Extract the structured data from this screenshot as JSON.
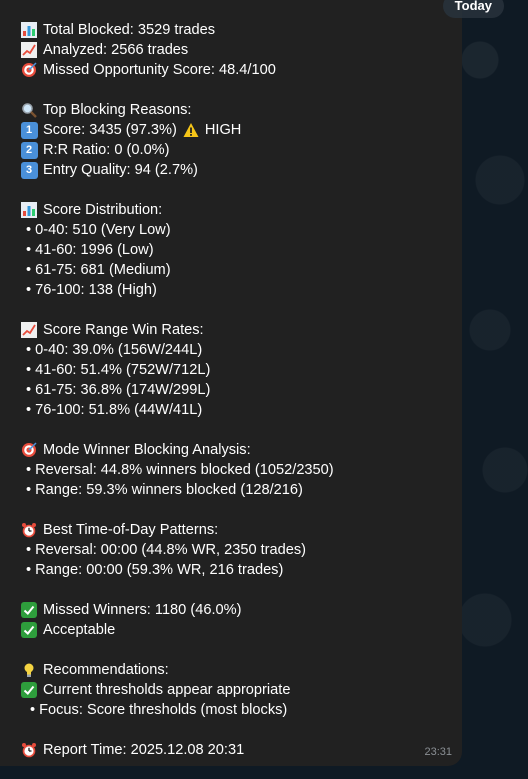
{
  "chat": {
    "date_label": "Today",
    "message_time": "23:31"
  },
  "message": {
    "summary": [
      "Total Blocked: 3529 trades",
      "Analyzed: 2566 trades",
      "Missed Opportunity Score: 48.4/100"
    ],
    "reasons": {
      "title": "Top Blocking Reasons:",
      "items": [
        {
          "key": "1",
          "text": "Score: 3435 (97.3%)",
          "badge": "HIGH"
        },
        {
          "key": "2",
          "text": "R:R Ratio: 0 (0.0%)"
        },
        {
          "key": "3",
          "text": "Entry Quality: 94 (2.7%)"
        }
      ]
    },
    "distribution": {
      "title": "Score Distribution:",
      "items": [
        "0-40: 510 (Very Low)",
        "41-60: 1996 (Low)",
        "61-75: 681 (Medium)",
        "76-100: 138 (High)"
      ]
    },
    "win_rates": {
      "title": "Score Range Win Rates:",
      "items": [
        "0-40: 39.0% (156W/244L)",
        "41-60: 51.4% (752W/712L)",
        "61-75: 36.8% (174W/299L)",
        "76-100: 51.8% (44W/41L)"
      ]
    },
    "mode": {
      "title": "Mode Winner Blocking Analysis:",
      "items": [
        "Reversal: 44.8% winners blocked (1052/2350)",
        "Range: 59.3% winners blocked (128/216)"
      ]
    },
    "time_patterns": {
      "title": "Best Time-of-Day Patterns:",
      "items": [
        "Reversal: 00:00 (44.8% WR, 2350 trades)",
        "Range: 00:00 (59.3% WR, 216 trades)"
      ]
    },
    "missed": {
      "line1": "Missed Winners: 1180 (46.0%)",
      "line2": "Acceptable"
    },
    "recommendations": {
      "title": "Recommendations:",
      "line1": "Current thresholds appear appropriate",
      "line2": "Focus: Score thresholds (most blocks)"
    },
    "report_time": "Report Time: 2025.12.08 20:31",
    "icons": {
      "chart": "bar-chart-icon",
      "trend": "chart-increasing-icon",
      "target": "direct-hit-icon",
      "search": "magnifier-icon",
      "warning": "warning-icon",
      "clock": "alarm-clock-icon",
      "check": "check-mark-button-icon",
      "bulb": "light-bulb-icon"
    },
    "colors": {
      "bubble": "#212121",
      "check": "#2e9d3c",
      "warning": "#f5c518",
      "key": "#4a90d9"
    }
  }
}
